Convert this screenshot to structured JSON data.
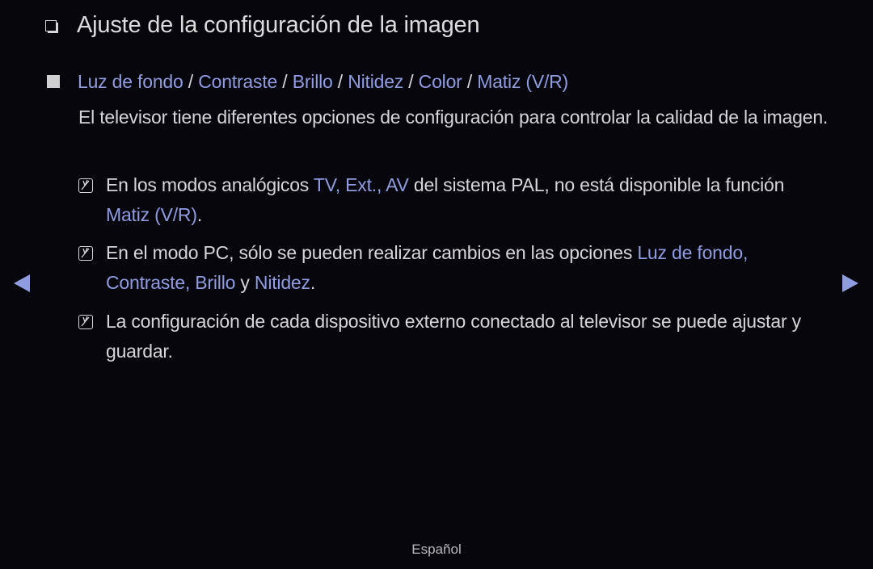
{
  "page": {
    "title": "Ajuste de la configuración de la imagen",
    "footer_language": "Español"
  },
  "section": {
    "heading_parts": [
      {
        "text": "Luz de fondo",
        "link": true
      },
      {
        "text": " / ",
        "link": false
      },
      {
        "text": "Contraste",
        "link": true
      },
      {
        "text": " / ",
        "link": false
      },
      {
        "text": "Brillo",
        "link": true
      },
      {
        "text": " / ",
        "link": false
      },
      {
        "text": "Nitidez",
        "link": true
      },
      {
        "text": " / ",
        "link": false
      },
      {
        "text": "Color",
        "link": true
      },
      {
        "text": " / ",
        "link": false
      },
      {
        "text": "Matiz (V/R)",
        "link": true
      }
    ],
    "description": "El televisor tiene diferentes opciones de configuración para controlar la calidad de la imagen."
  },
  "notes": [
    {
      "parts": [
        {
          "text": "En los modos analógicos ",
          "hl": false
        },
        {
          "text": "TV, Ext., AV",
          "hl": true
        },
        {
          "text": " del sistema PAL, no está disponible la función ",
          "hl": false
        },
        {
          "text": "Matiz (V/R)",
          "hl": true
        },
        {
          "text": ".",
          "hl": false
        }
      ]
    },
    {
      "parts": [
        {
          "text": "En el modo PC, sólo se pueden realizar cambios en las opciones ",
          "hl": false
        },
        {
          "text": "Luz de fondo, Contraste, Brillo",
          "hl": true
        },
        {
          "text": " y ",
          "hl": false
        },
        {
          "text": "Nitidez",
          "hl": true
        },
        {
          "text": ".",
          "hl": false
        }
      ]
    },
    {
      "parts": [
        {
          "text": "La configuración de cada dispositivo externo conectado al televisor se puede ajustar y guardar.",
          "hl": false
        }
      ]
    }
  ],
  "navigation": {
    "prev_icon": "left-triangle-arrow",
    "next_icon": "right-triangle-arrow"
  },
  "colors": {
    "background": "#07060d",
    "text": "#d6d6d8",
    "accent": "#8f9ce0"
  }
}
